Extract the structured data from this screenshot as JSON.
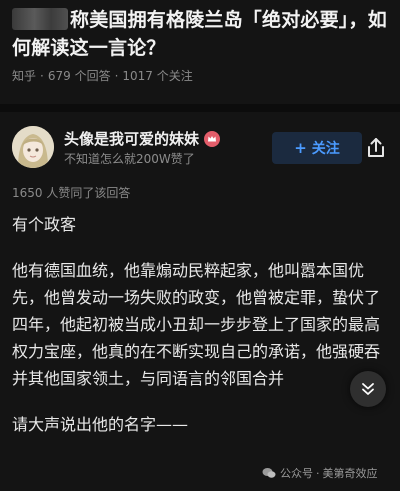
{
  "question": {
    "title": "称美国拥有格陵兰岛「绝对必要」，如何解读这一言论？",
    "source": "知乎",
    "answers_count": "679 个回答",
    "followers_count": "1017 个关注"
  },
  "author": {
    "name": "头像是我可爱的妹妹",
    "subtitle": "不知道怎么就200W赞了",
    "follow_label": "关注",
    "follow_prefix": "+"
  },
  "answer": {
    "likes_text": "1650 人赞同了该回答",
    "paragraphs": [
      "有个政客",
      "他有德国血统，他靠煽动民粹起家，他叫嚣本国优先，他曾发动一场失败的政变，他曾被定罪，蛰伏了四年，他起初被当成小丑却一步步登上了国家的最高权力宝座，他真的在不断实现自己的承诺，他强硬吞并其他国家领土，与同语言的邻国合并",
      "请大声说出他的名字——"
    ]
  },
  "watermark": {
    "platform": "公众号",
    "account": "美第奇效应"
  },
  "colors": {
    "background": "#141414",
    "accent_blue": "#4b9bff",
    "follow_bg": "#1b2a3f",
    "muted_text": "#8a8a8a"
  },
  "icons": [
    "share-icon",
    "chevron-down-icon",
    "crown-badge-icon",
    "wechat-icon"
  ]
}
